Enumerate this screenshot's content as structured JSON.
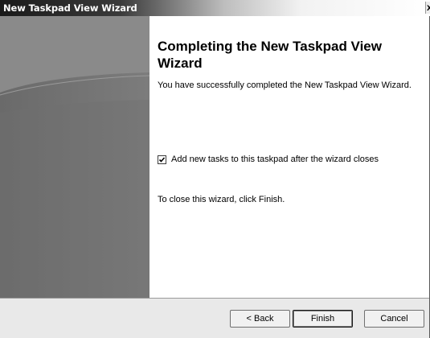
{
  "window": {
    "title": "New Taskpad View Wizard",
    "close_glyph": "x"
  },
  "content": {
    "heading": "Completing the New Taskpad View Wizard",
    "description": "You have successfully completed the New Taskpad View Wizard.",
    "checkbox": {
      "label": "Add new tasks to this taskpad after the wizard closes",
      "checked": true
    },
    "close_instruction": "To close this wizard, click Finish."
  },
  "buttons": {
    "back": "< Back",
    "finish": "Finish",
    "cancel": "Cancel"
  }
}
